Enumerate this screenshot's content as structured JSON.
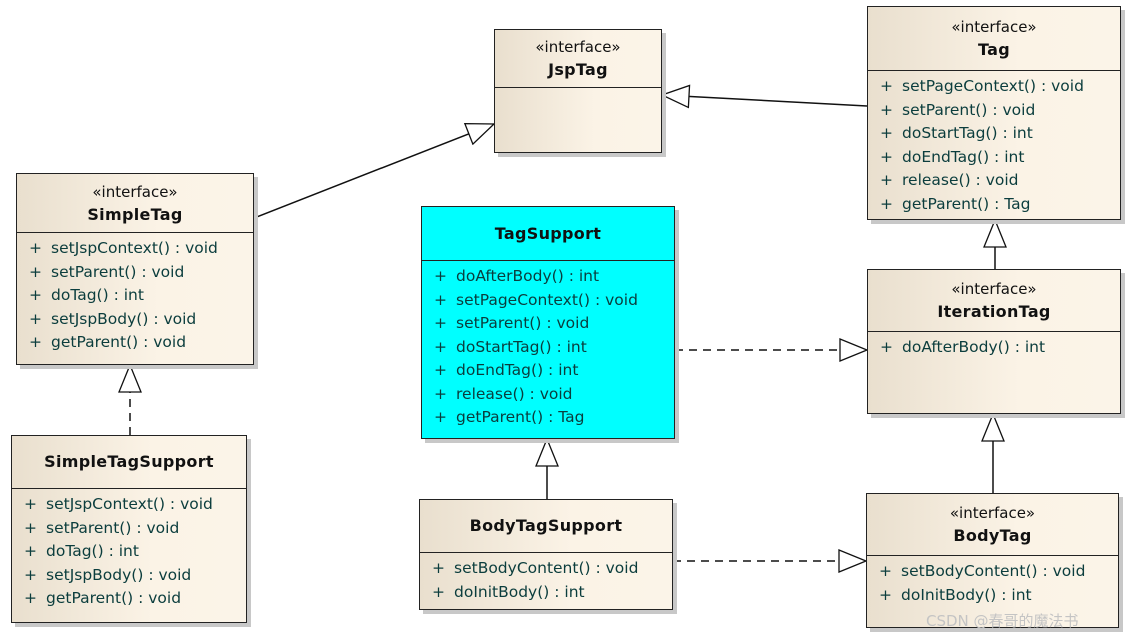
{
  "classes": {
    "jsptag": {
      "stereotype": "«interface»",
      "name": "JspTag",
      "members": []
    },
    "tag": {
      "stereotype": "«interface»",
      "name": "Tag",
      "members": [
        "setPageContext() : void",
        "setParent() : void",
        "doStartTag() : int",
        "doEndTag() : int",
        "release() : void",
        "getParent() : Tag"
      ]
    },
    "simpletag": {
      "stereotype": "«interface»",
      "name": "SimpleTag",
      "members": [
        "setJspContext() : void",
        "setParent() : void",
        "doTag() : int",
        "setJspBody() : void",
        "getParent() : void"
      ]
    },
    "tagsupport": {
      "name": "TagSupport",
      "members": [
        "doAfterBody() : int",
        "setPageContext() : void",
        "setParent() : void",
        "doStartTag() : int",
        "doEndTag() : int",
        "release() : void",
        "getParent() : Tag"
      ]
    },
    "iterationtag": {
      "stereotype": "«interface»",
      "name": "IterationTag",
      "members": [
        "doAfterBody() : int"
      ]
    },
    "simpletagsupport": {
      "name": "SimpleTagSupport",
      "members": [
        "setJspContext() : void",
        "setParent() : void",
        "doTag() : int",
        "setJspBody() : void",
        "getParent() : void"
      ]
    },
    "bodytagsupport": {
      "name": "BodyTagSupport",
      "members": [
        "setBodyContent() : void",
        "doInitBody() : int"
      ]
    },
    "bodytag": {
      "stereotype": "«interface»",
      "name": "BodyTag",
      "members": [
        "setBodyContent() : void",
        "doInitBody() : int"
      ]
    }
  },
  "visibility": "+",
  "colors": {
    "highlight": "#00ffff",
    "member_text": "#0b3d3d"
  },
  "watermark": "CSDN @春哥的魔法书"
}
